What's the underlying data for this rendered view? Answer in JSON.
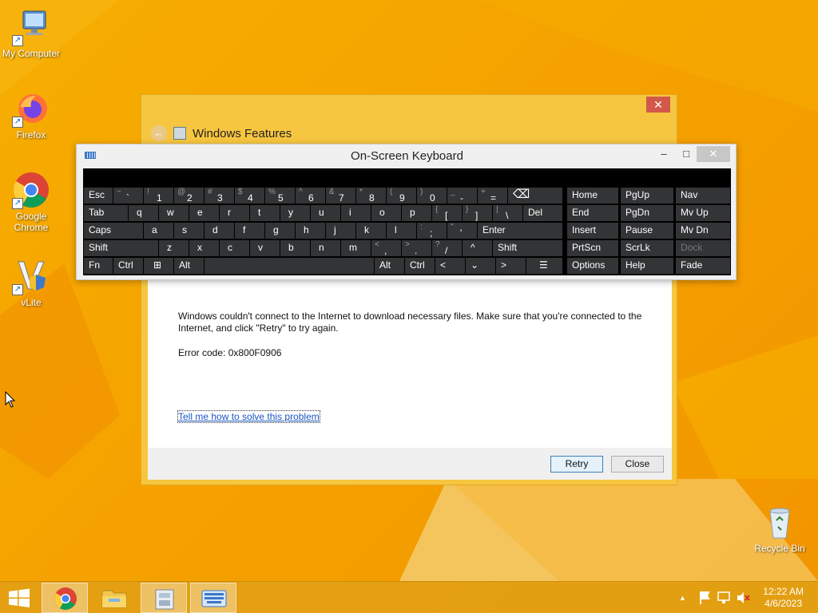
{
  "desktop": {
    "icons": [
      {
        "label": "My Computer",
        "icon": "computer-icon"
      },
      {
        "label": "Firefox",
        "icon": "firefox-icon"
      },
      {
        "label": "Google Chrome",
        "icon": "chrome-icon"
      },
      {
        "label": "vLite",
        "icon": "vlite-icon"
      },
      {
        "label": "Recycle Bin",
        "icon": "recycle-bin-icon"
      }
    ]
  },
  "features_dialog": {
    "title": "Windows Features",
    "close_glyph": "✕",
    "back_glyph": "←",
    "message": "Windows couldn't connect to the Internet to download necessary files. Make sure that you're connected to the Internet, and click \"Retry\" to try again.",
    "error_code": "Error code: 0x800F0906",
    "help_link": "Tell me how to solve this problem",
    "retry_label": "Retry",
    "close_label": "Close"
  },
  "osk": {
    "title": "On-Screen Keyboard",
    "minimize_glyph": "–",
    "maximize_glyph": "□",
    "close_glyph": "✕",
    "keys": {
      "esc": "Esc",
      "tilde_top": "~",
      "tilde_main": "`",
      "k1_top": "!",
      "k1": "1",
      "k2_top": "@",
      "k2": "2",
      "k3_top": "#",
      "k3": "3",
      "k4_top": "$",
      "k4": "4",
      "k5_top": "%",
      "k5": "5",
      "k6_top": "^",
      "k6": "6",
      "k7_top": "&",
      "k7": "7",
      "k8_top": "*",
      "k8": "8",
      "k9_top": "(",
      "k9": "9",
      "k0_top": ")",
      "k0": "0",
      "minus_top": "_",
      "minus": "-",
      "equals_top": "+",
      "equals": "=",
      "backspace": "⌫",
      "tab": "Tab",
      "q": "q",
      "w": "w",
      "e": "e",
      "r": "r",
      "t": "t",
      "y": "y",
      "u": "u",
      "i": "i",
      "o": "o",
      "p": "p",
      "lbracket_top": "{",
      "lbracket": "[",
      "rbracket_top": "}",
      "rbracket": "]",
      "backslash_top": "|",
      "backslash": "\\",
      "del": "Del",
      "caps": "Caps",
      "a": "a",
      "s": "s",
      "d": "d",
      "f": "f",
      "g": "g",
      "h": "h",
      "j": "j",
      "k": "k",
      "l": "l",
      "semicolon_top": ":",
      "semicolon": ";",
      "quote_top": "\"",
      "quote": "'",
      "enter": "Enter",
      "shift": "Shift",
      "z": "z",
      "x": "x",
      "c": "c",
      "v": "v",
      "b": "b",
      "n": "n",
      "m": "m",
      "comma_top": "<",
      "comma": ",",
      "period_top": ">",
      "period": ".",
      "slash_top": "?",
      "slash": "/",
      "up": "^",
      "rshift": "Shift",
      "fn": "Fn",
      "ctrl": "Ctrl",
      "win": "⊞",
      "alt": "Alt",
      "ralt": "Alt",
      "rctrl": "Ctrl",
      "left": "<",
      "down": "⌄",
      "right": ">",
      "menu": "☰",
      "home": "Home",
      "pgup": "PgUp",
      "nav": "Nav",
      "end": "End",
      "pgdn": "PgDn",
      "mvup": "Mv Up",
      "insert": "Insert",
      "pause": "Pause",
      "mvdn": "Mv Dn",
      "prtscn": "PrtScn",
      "scrlk": "ScrLk",
      "dock": "Dock",
      "options": "Options",
      "help": "Help",
      "fade": "Fade"
    }
  },
  "taskbar": {
    "start_icon": "windows-start-icon",
    "clock_time": "12:22 AM",
    "clock_date": "4/6/2023",
    "tray_chevron": "▲"
  },
  "colors": {
    "desktop_bg": "#f5a800",
    "key_bg": "#333436",
    "key_text": "#ffffff"
  }
}
